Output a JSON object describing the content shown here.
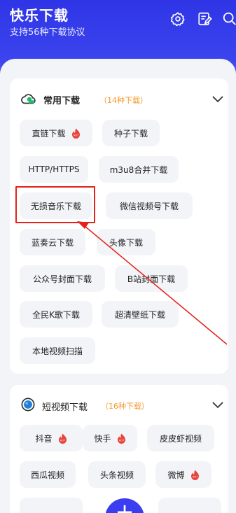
{
  "header": {
    "title": "快乐下载",
    "subtitle": "支持56种下载协议",
    "icons": [
      "settings-icon",
      "edit-note-icon",
      "search-icon"
    ]
  },
  "categories": [
    {
      "title": "常用下载",
      "count": "（14种下载）",
      "icon": "cloud-icon",
      "items": [
        {
          "label": "直链下载",
          "hot": true
        },
        {
          "label": "种子下载",
          "hot": false
        },
        {
          "label": "HTTP/HTTPS",
          "hot": false
        },
        {
          "label": "m3u8合并下载",
          "hot": false
        },
        {
          "label": "无损音乐下载",
          "hot": false
        },
        {
          "label": "微信视频号下载",
          "hot": false
        },
        {
          "label": "蓝奏云下载",
          "hot": false
        },
        {
          "label": "头像下载",
          "hot": false
        },
        {
          "label": "公众号封面下载",
          "hot": false
        },
        {
          "label": "B站封面下载",
          "hot": false
        },
        {
          "label": "全民K歌下载",
          "hot": false
        },
        {
          "label": "超清壁纸下载",
          "hot": false
        },
        {
          "label": "本地视频扫描",
          "hot": false
        }
      ]
    },
    {
      "title": "短视频下载",
      "count": "（16种下载）",
      "icon": "video-circle-icon",
      "items": [
        {
          "label": "抖音",
          "hot": true
        },
        {
          "label": "快手",
          "hot": true
        },
        {
          "label": "皮皮虾视频",
          "hot": false
        },
        {
          "label": "西瓜视频",
          "hot": false
        },
        {
          "label": "头条视频",
          "hot": false
        },
        {
          "label": "微博",
          "hot": true
        }
      ]
    }
  ],
  "fab": {
    "label": "+"
  },
  "colors": {
    "accent": "#3b3ef0",
    "highlight": "#e6211b",
    "count": "#f29a2e",
    "hot": "#e8423b"
  }
}
